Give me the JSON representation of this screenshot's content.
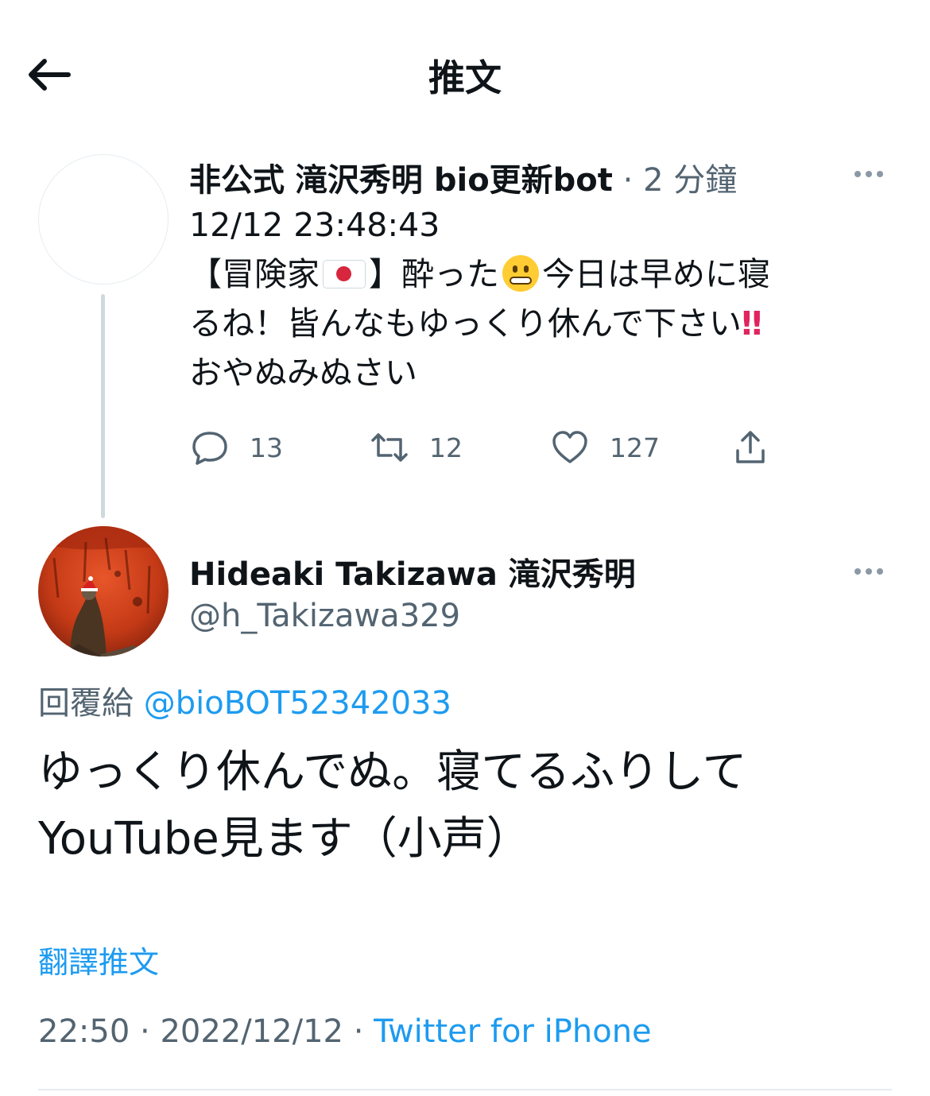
{
  "header": {
    "title": "推文"
  },
  "parent_tweet": {
    "name": "非公式 滝沢秀明 bio更新bot",
    "separator": " · ",
    "time_ago": "2 分鐘",
    "lines": [
      "12/12 23:48:43",
      "【冒険家",
      "】酔った",
      "今日は早めに寝",
      "るね！皆んなもゆっくり休んで下さい",
      "‼",
      "おやぬみぬさい"
    ],
    "reply_count": "13",
    "retweet_count": "12",
    "like_count": "127"
  },
  "main_tweet": {
    "name": "Hideaki Takizawa 滝沢秀明",
    "handle": "@h_Takizawa329",
    "replying_label": "回覆給",
    "replying_to": "@bioBOT52342033",
    "lines": [
      "ゆっくり休んでぬ。寝てるふりして",
      "YouTube見ます（小声）"
    ],
    "translate_label": "翻譯推文",
    "time": "22:50",
    "date": "2022/12/12",
    "separator": " · ",
    "source": "Twitter for iPhone"
  },
  "icons": {
    "back": "arrow-left-icon",
    "more": "more-icon",
    "reply": "reply-icon",
    "retweet": "retweet-icon",
    "like": "heart-icon",
    "share": "share-icon"
  },
  "colors": {
    "accent": "#1d9bf0",
    "muted": "#536471",
    "text": "#0f1419"
  }
}
